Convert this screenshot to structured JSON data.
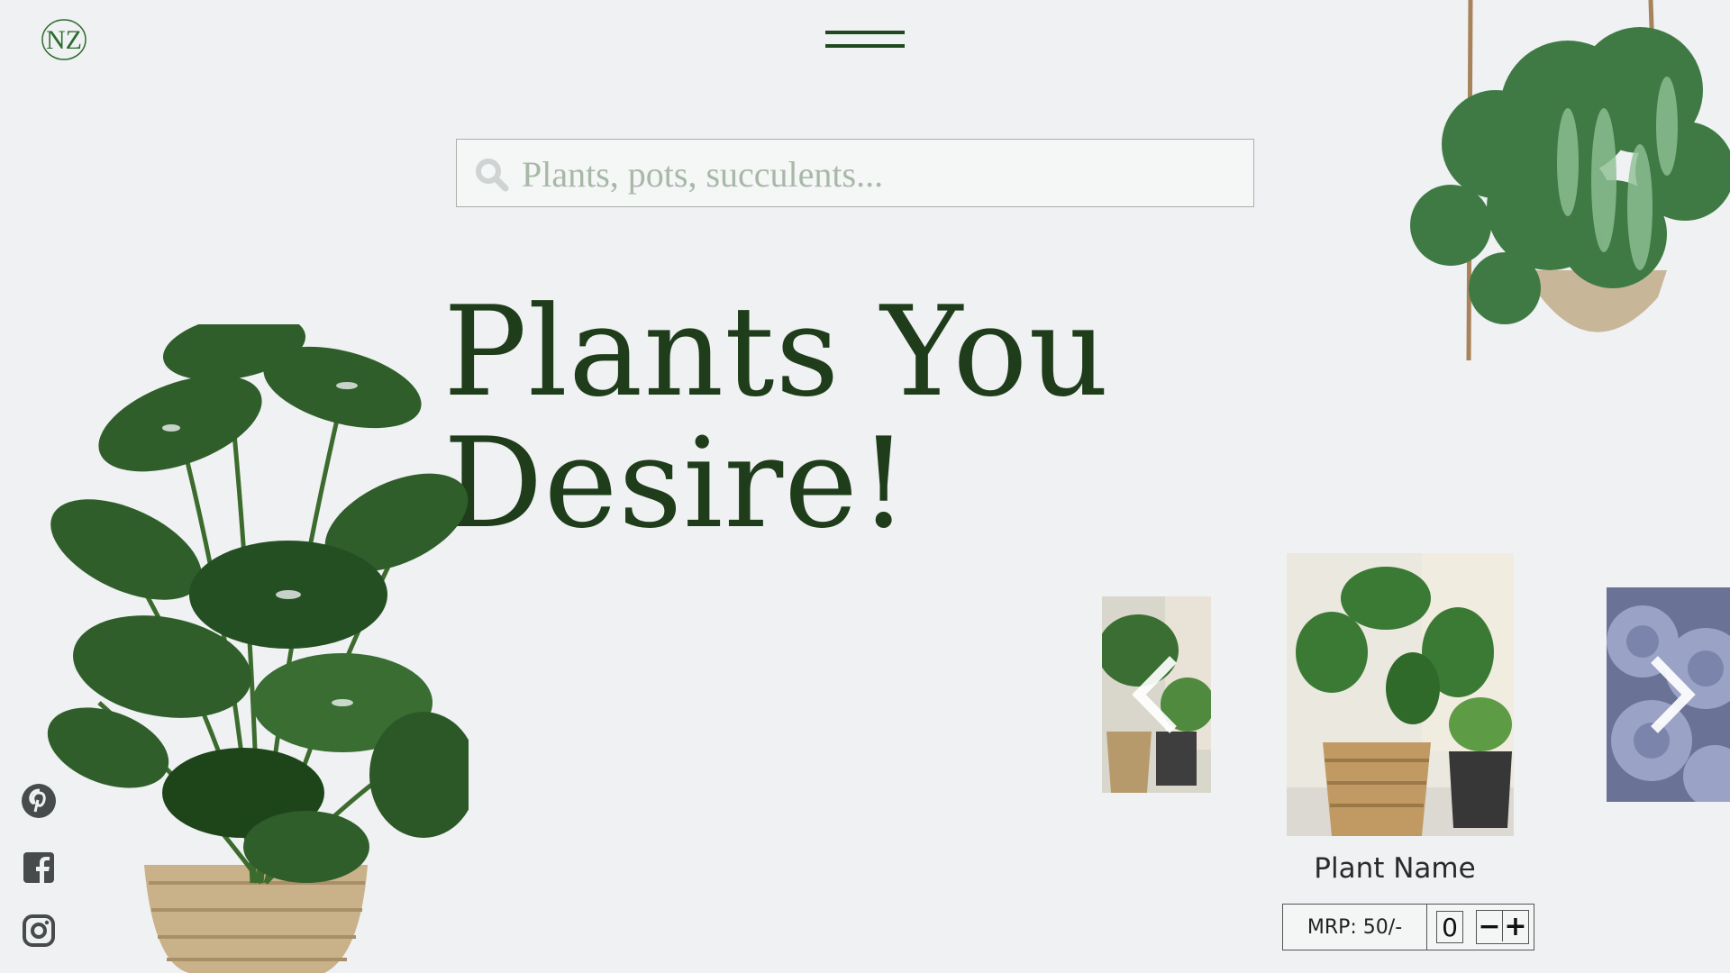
{
  "brand": {
    "logo_text": "NZ",
    "accent": "#1f4a1f",
    "heading_color": "#1f3d1a"
  },
  "header": {
    "menu_icon": "hamburger-icon"
  },
  "search": {
    "placeholder": "Plants, pots, succulents...",
    "value": "",
    "icon": "search-icon"
  },
  "hero": {
    "line1": "Plants You",
    "line2": "Desire!"
  },
  "social": [
    {
      "name": "pinterest-icon"
    },
    {
      "name": "facebook-icon"
    },
    {
      "name": "instagram-icon"
    }
  ],
  "carousel": {
    "prev_icon": "chevron-left-icon",
    "next_icon": "chevron-right-icon",
    "current": {
      "name": "Plant Name",
      "price": "MRP: 50/-",
      "quantity": "0",
      "minus_label": "−",
      "plus_label": "+"
    }
  }
}
